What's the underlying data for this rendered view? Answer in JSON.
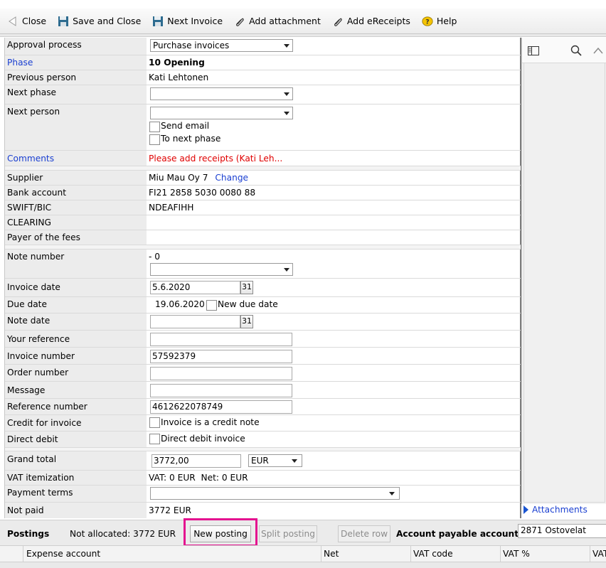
{
  "toolbar": {
    "close_label": "Close",
    "save_close_label": "Save and Close",
    "next_invoice_label": "Next Invoice",
    "add_attachment_label": "Add attachment",
    "add_ereceipts_label": "Add eReceipts",
    "help_label": "Help"
  },
  "form": {
    "approval_process_label": "Approval process",
    "approval_process_value": "Purchase invoices",
    "phase_label": "Phase",
    "phase_value": "10 Opening",
    "previous_person_label": "Previous person",
    "previous_person_value": "Kati Lehtonen",
    "next_phase_label": "Next phase",
    "next_phase_value": "",
    "next_person_label": "Next person",
    "next_person_value": "",
    "send_email_label": "Send email",
    "to_next_phase_label": "To next phase",
    "comments_label": "Comments",
    "comments_value": "Please add receipts (Kati Leh...",
    "supplier_label": "Supplier",
    "supplier_value": "Miu Mau Oy 7",
    "supplier_change": "Change",
    "bank_account_label": "Bank account",
    "bank_account_value": "FI21 2858 5030 0080 88",
    "swift_label": "SWIFT/BIC",
    "swift_value": "NDEAFIHH",
    "clearing_label": "CLEARING",
    "payer_fees_label": "Payer of the fees",
    "note_number_label": "Note number",
    "note_number_value": "- 0",
    "invoice_date_label": "Invoice date",
    "invoice_date_value": "5.6.2020",
    "calendar_label": "31",
    "due_date_label": "Due date",
    "due_date_value": "19.06.2020",
    "new_due_date_label": "New due date",
    "note_date_label": "Note date",
    "note_date_value": "",
    "your_reference_label": "Your reference",
    "your_reference_value": "",
    "invoice_number_label": "Invoice number",
    "invoice_number_value": "57592379",
    "order_number_label": "Order number",
    "order_number_value": "",
    "message_label": "Message",
    "message_value": "",
    "reference_number_label": "Reference number",
    "reference_number_value": "4612622078749",
    "credit_label": "Credit for invoice",
    "credit_check_label": "Invoice is a credit note",
    "direct_debit_label": "Direct debit",
    "direct_debit_check_label": "Direct debit invoice",
    "grand_total_label": "Grand total",
    "grand_total_value": "3772,00",
    "currency_value": "EUR",
    "vat_itemization_label": "VAT itemization",
    "vat_itemization_value": "VAT: 0 EUR  Net: 0 EUR",
    "payment_terms_label": "Payment terms",
    "payment_terms_value": "",
    "not_paid_label": "Not paid",
    "not_paid_value": "3772 EUR"
  },
  "attachments": {
    "label": "Attachments"
  },
  "postings": {
    "title": "Postings",
    "not_allocated": "Not allocated: 3772 EUR",
    "new_posting_label": "New posting",
    "split_posting_label": "Split posting",
    "delete_row_label": "Delete row",
    "account_payable_label": "Account payable account",
    "account_payable_value": "2871 Ostovelat"
  },
  "grid": {
    "columns": [
      "Expense account",
      "Net",
      "VAT code",
      "VAT %",
      "VAT"
    ]
  },
  "icons": {
    "close": "back-arrow-icon",
    "save": "floppy-disk-icon",
    "next_invoice": "floppy-disk-icon",
    "attachment": "paperclip-icon",
    "ereceipts": "paperclip-icon",
    "help": "help-icon",
    "panel": "panel-toggle-icon",
    "search": "search-icon",
    "collapse": "chevron-up-icon"
  },
  "colors": {
    "link": "#1a3fd1",
    "comment": "#e00000",
    "highlight": "#e4118f"
  }
}
